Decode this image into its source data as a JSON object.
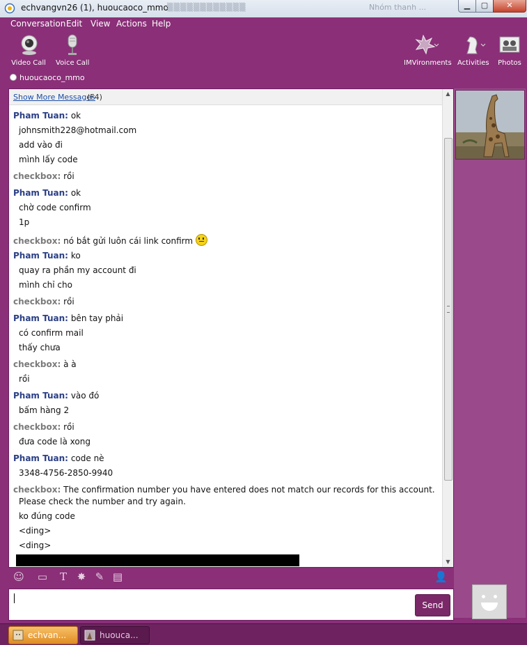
{
  "titlebar": {
    "title": "echvangvn26 (1), huoucaoco_mmo",
    "background_text": "Nhóm thanh ..."
  },
  "menu": [
    "Conversation",
    "Edit",
    "View",
    "Actions",
    "Help"
  ],
  "toolbar": {
    "video_call": "Video Call",
    "voice_call": "Voice Call",
    "imvironments": "IMVironments",
    "activities": "Activities",
    "photos": "Photos"
  },
  "contact": {
    "name": "huoucaoco_mmo"
  },
  "conversation": {
    "show_more": "Show More Messages",
    "show_more_key": "(F4)",
    "messages": [
      {
        "sender": "Pham Tuan",
        "text": "ok",
        "lines": [
          "johnsmith228@hotmail.com",
          "add vào đi",
          "mình lấy code"
        ]
      },
      {
        "sender": "checkbox",
        "text": "rồi",
        "lines": []
      },
      {
        "sender": "Pham Tuan",
        "text": "ok",
        "lines": [
          "chờ code confirm",
          "1p"
        ]
      },
      {
        "sender": "checkbox",
        "text": "nó bắt gửi luôn cái link confirm",
        "lines": []
      },
      {
        "sender": "Pham Tuan",
        "text": "ko",
        "lines": [
          "quay ra phần my account đi",
          "mình chỉ cho"
        ]
      },
      {
        "sender": "checkbox",
        "text": "rồi",
        "lines": []
      },
      {
        "sender": "Pham Tuan",
        "text": "bên tay phải",
        "lines": [
          "có confirm mail",
          "thấy chưa"
        ]
      },
      {
        "sender": "checkbox",
        "text": "à à",
        "lines": [
          "rồi"
        ]
      },
      {
        "sender": "Pham Tuan",
        "text": "vào đó",
        "lines": [
          "bấm hàng 2"
        ]
      },
      {
        "sender": "checkbox",
        "text": "rồi",
        "lines": [
          "đưa code là xong"
        ]
      },
      {
        "sender": "Pham Tuan",
        "text": "code nè",
        "lines": [
          "3348-4756-2850-9940"
        ]
      },
      {
        "sender": "checkbox",
        "text": "The confirmation number you have entered does not match our records for this account.",
        "lines": [
          "Please check the number and try again.",
          "ko đúng code",
          "<ding>",
          "<ding>"
        ]
      }
    ]
  },
  "input": {
    "send_label": "Send"
  },
  "taskbar": {
    "items": [
      "echvan...",
      "huouca..."
    ]
  }
}
